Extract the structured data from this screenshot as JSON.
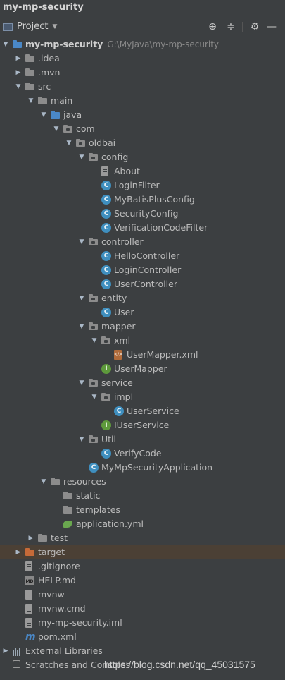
{
  "window": {
    "title": "my-mp-security"
  },
  "toolbar": {
    "project_label": "Project"
  },
  "tree": [
    {
      "label": "my-mp-security",
      "path": "G:\\MyJava\\my-mp-security",
      "depth": 0,
      "arrow": "down",
      "icon": "module"
    },
    {
      "label": ".idea",
      "depth": 1,
      "arrow": "right",
      "icon": "folder"
    },
    {
      "label": ".mvn",
      "depth": 1,
      "arrow": "right",
      "icon": "folder"
    },
    {
      "label": "src",
      "depth": 1,
      "arrow": "down",
      "icon": "folder"
    },
    {
      "label": "main",
      "depth": 2,
      "arrow": "down",
      "icon": "folder"
    },
    {
      "label": "java",
      "depth": 3,
      "arrow": "down",
      "icon": "folder-blue"
    },
    {
      "label": "com",
      "depth": 4,
      "arrow": "down",
      "icon": "package"
    },
    {
      "label": "oldbai",
      "depth": 5,
      "arrow": "down",
      "icon": "package"
    },
    {
      "label": "config",
      "depth": 6,
      "arrow": "down",
      "icon": "package"
    },
    {
      "label": "About",
      "depth": 7,
      "arrow": "",
      "icon": "file"
    },
    {
      "label": "LoginFilter",
      "depth": 7,
      "arrow": "",
      "icon": "class"
    },
    {
      "label": "MyBatisPlusConfig",
      "depth": 7,
      "arrow": "",
      "icon": "class"
    },
    {
      "label": "SecurityConfig",
      "depth": 7,
      "arrow": "",
      "icon": "class"
    },
    {
      "label": "VerificationCodeFilter",
      "depth": 7,
      "arrow": "",
      "icon": "class"
    },
    {
      "label": "controller",
      "depth": 6,
      "arrow": "down",
      "icon": "package"
    },
    {
      "label": "HelloController",
      "depth": 7,
      "arrow": "",
      "icon": "class"
    },
    {
      "label": "LoginController",
      "depth": 7,
      "arrow": "",
      "icon": "class"
    },
    {
      "label": "UserController",
      "depth": 7,
      "arrow": "",
      "icon": "class"
    },
    {
      "label": "entity",
      "depth": 6,
      "arrow": "down",
      "icon": "package"
    },
    {
      "label": "User",
      "depth": 7,
      "arrow": "",
      "icon": "class"
    },
    {
      "label": "mapper",
      "depth": 6,
      "arrow": "down",
      "icon": "package"
    },
    {
      "label": "xml",
      "depth": 7,
      "arrow": "down",
      "icon": "package"
    },
    {
      "label": "UserMapper.xml",
      "depth": 8,
      "arrow": "",
      "icon": "xml"
    },
    {
      "label": "UserMapper",
      "depth": 7,
      "arrow": "",
      "icon": "interface"
    },
    {
      "label": "service",
      "depth": 6,
      "arrow": "down",
      "icon": "package"
    },
    {
      "label": "impl",
      "depth": 7,
      "arrow": "down",
      "icon": "package"
    },
    {
      "label": "UserService",
      "depth": 8,
      "arrow": "",
      "icon": "class"
    },
    {
      "label": "IUserService",
      "depth": 7,
      "arrow": "",
      "icon": "interface"
    },
    {
      "label": "Util",
      "depth": 6,
      "arrow": "down",
      "icon": "package"
    },
    {
      "label": "VerifyCode",
      "depth": 7,
      "arrow": "",
      "icon": "class"
    },
    {
      "label": "MyMpSecurityApplication",
      "depth": 6,
      "arrow": "",
      "icon": "spring-class"
    },
    {
      "label": "resources",
      "depth": 3,
      "arrow": "down",
      "icon": "folder-res"
    },
    {
      "label": "static",
      "depth": 4,
      "arrow": "",
      "icon": "folder"
    },
    {
      "label": "templates",
      "depth": 4,
      "arrow": "",
      "icon": "folder"
    },
    {
      "label": "application.yml",
      "depth": 4,
      "arrow": "",
      "icon": "spring"
    },
    {
      "label": "test",
      "depth": 2,
      "arrow": "right",
      "icon": "folder"
    },
    {
      "label": "target",
      "depth": 1,
      "arrow": "right",
      "icon": "folder-orange",
      "selected": true
    },
    {
      "label": ".gitignore",
      "depth": 1,
      "arrow": "",
      "icon": "file"
    },
    {
      "label": "HELP.md",
      "depth": 1,
      "arrow": "",
      "icon": "md"
    },
    {
      "label": "mvnw",
      "depth": 1,
      "arrow": "",
      "icon": "file"
    },
    {
      "label": "mvnw.cmd",
      "depth": 1,
      "arrow": "",
      "icon": "file"
    },
    {
      "label": "my-mp-security.iml",
      "depth": 1,
      "arrow": "",
      "icon": "file"
    },
    {
      "label": "pom.xml",
      "depth": 1,
      "arrow": "",
      "icon": "maven"
    },
    {
      "label": "External Libraries",
      "depth": 0,
      "arrow": "right",
      "icon": "libraries"
    },
    {
      "label": "Scratches and Consoles",
      "depth": 0,
      "arrow": "",
      "icon": "scratch"
    }
  ],
  "watermark": "https://blog.csdn.net/qq_45031575"
}
